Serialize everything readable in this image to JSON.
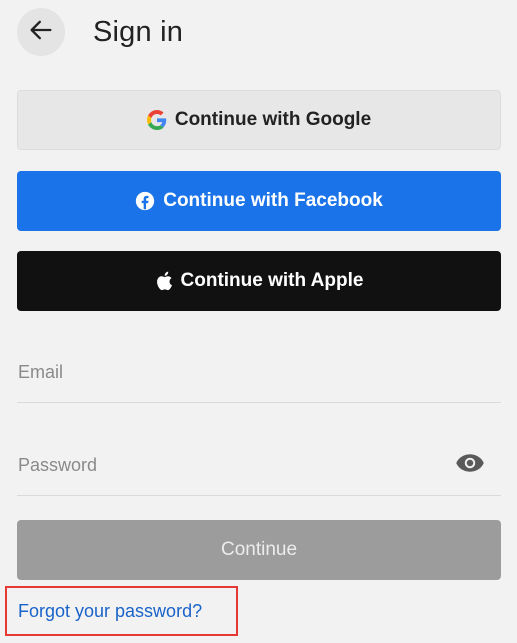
{
  "header": {
    "title": "Sign in",
    "back_icon": "arrow-left-icon"
  },
  "social": {
    "google": {
      "label": "Continue with Google",
      "icon": "google-logo-icon"
    },
    "facebook": {
      "label": "Continue with Facebook",
      "icon": "facebook-logo-icon",
      "color": "#1a73e8"
    },
    "apple": {
      "label": "Continue with Apple",
      "icon": "apple-logo-icon",
      "color": "#111111"
    }
  },
  "form": {
    "email": {
      "placeholder": "Email",
      "value": ""
    },
    "password": {
      "placeholder": "Password",
      "value": "",
      "toggle_icon": "eye-icon"
    },
    "continue_label": "Continue"
  },
  "links": {
    "forgot_password": "Forgot your password?"
  },
  "highlight": {
    "color": "#e53935",
    "target": "forgot-password-link"
  }
}
